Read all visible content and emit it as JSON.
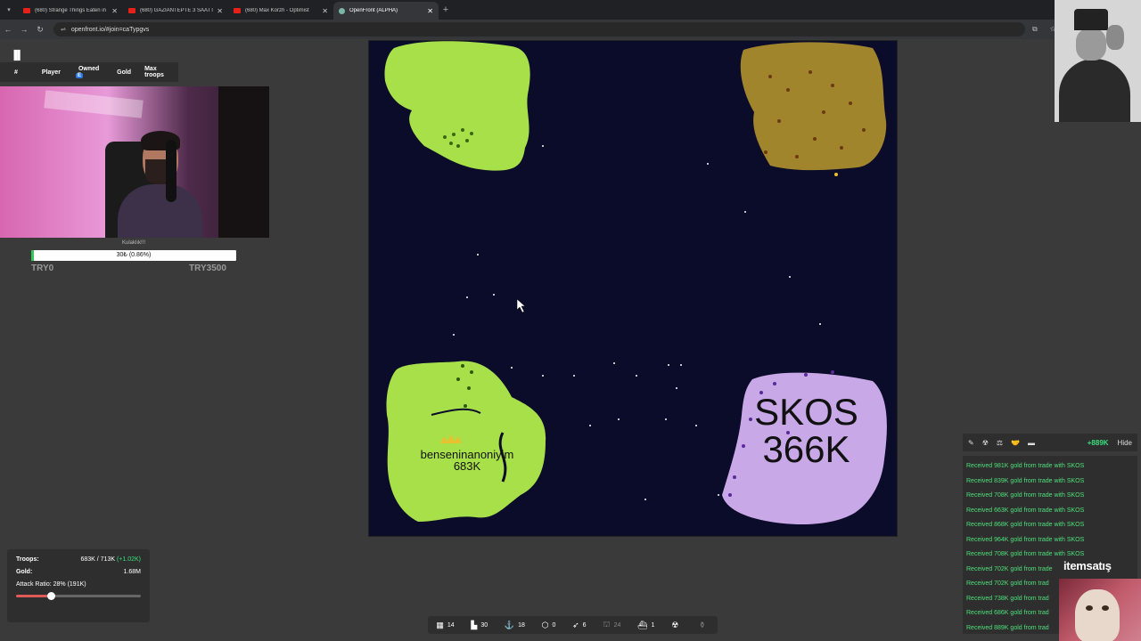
{
  "browser": {
    "tabs": [
      {
        "title": "(680) Strange Things Eaten in H",
        "active": false
      },
      {
        "title": "(680) GAZİANTEPTE 3 SAATTE",
        "active": false
      },
      {
        "title": "(680) Max Korzh - Optimist",
        "active": false
      },
      {
        "title": "OpenFront (ALPHA)",
        "active": true
      }
    ],
    "url": "openfront.io/#join=caTypgvs"
  },
  "leaderboard": {
    "columns": [
      "#",
      "Player",
      "Owned",
      "Gold",
      "Max troops"
    ],
    "owned_badge": "E"
  },
  "donation": {
    "title": "Kulaklık!!!",
    "progress_text": "30₺ (0.86%)",
    "progress_fraction": 0.0086,
    "min_label": "TRY0",
    "max_label": "TRY3500"
  },
  "map": {
    "players": [
      {
        "name": "benseninanoniyim",
        "troops": "683K",
        "color": "#a8e04a"
      },
      {
        "name": "SKOS",
        "troops": "366K",
        "color": "#c9a8e8"
      }
    ],
    "colors": {
      "ocean": "#0b0b2a",
      "green": "#a8e04a",
      "gold": "#a0852c",
      "purple": "#c9a8e8"
    }
  },
  "stats": {
    "troops_label": "Troops:",
    "troops_value": "683K / 713K",
    "troops_gain": "(+1.02K)",
    "gold_label": "Gold:",
    "gold_value": "1.68M",
    "attack_ratio": "Attack Ratio: 28% (191K)",
    "attack_ratio_fraction": 0.28
  },
  "buildbar": [
    {
      "icon": "city-icon",
      "glyph": "▦",
      "count": "14",
      "dim": false
    },
    {
      "icon": "factory-icon",
      "glyph": "▙",
      "count": "30",
      "dim": false
    },
    {
      "icon": "port-icon",
      "glyph": "⚓",
      "count": "18",
      "dim": false
    },
    {
      "icon": "defense-icon",
      "glyph": "⬡",
      "count": "0",
      "dim": false
    },
    {
      "icon": "missile-icon",
      "glyph": "➶",
      "count": "6",
      "dim": false
    },
    {
      "icon": "sam-icon",
      "glyph": "⛫",
      "count": "24",
      "dim": true
    },
    {
      "icon": "warship-icon",
      "glyph": "⛴",
      "count": "1",
      "dim": false
    },
    {
      "icon": "nuke-icon",
      "glyph": "☢",
      "count": "",
      "dim": false
    },
    {
      "icon": "silo-icon",
      "glyph": "⚱",
      "count": "",
      "dim": true
    }
  ],
  "events": {
    "gold_gain": "+889K",
    "hide_label": "Hide",
    "messages": [
      "Received 981K gold from trade with SKOS",
      "Received 839K gold from trade with SKOS",
      "Received 708K gold from trade with SKOS",
      "Received 663K gold from trade with SKOS",
      "Received 868K gold from trade with SKOS",
      "Received 964K gold from trade with SKOS",
      "Received 708K gold from trade with SKOS",
      "Received 702K gold from trade",
      "Received 702K gold from trad",
      "Received 738K gold from trad",
      "Received 686K gold from trad",
      "Received 889K gold from trad"
    ]
  },
  "overlay": {
    "brand": "itemsatış"
  }
}
